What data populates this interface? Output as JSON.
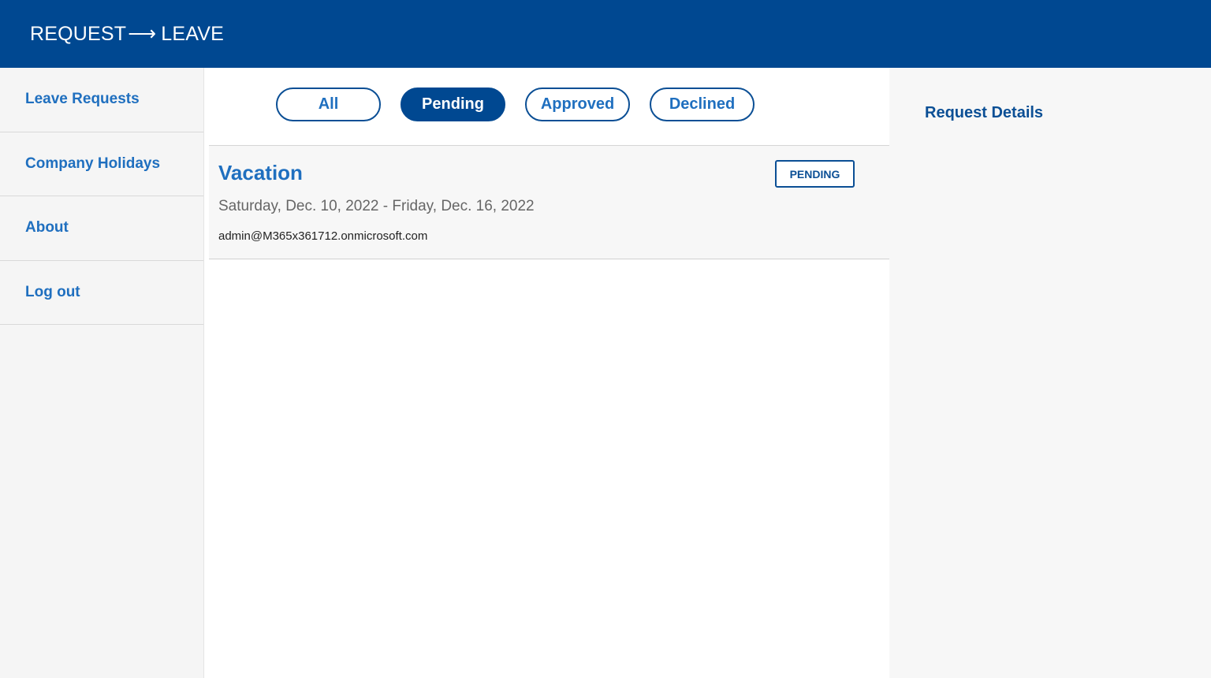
{
  "header": {
    "brand_left": "REQUEST",
    "brand_arrow": "⟶",
    "brand_right": "LEAVE",
    "color": "#004891"
  },
  "sidebar": {
    "items": [
      {
        "label": "Leave Requests"
      },
      {
        "label": "Company Holidays"
      },
      {
        "label": "About"
      },
      {
        "label": "Log out"
      }
    ]
  },
  "filters": {
    "items": [
      {
        "label": "All"
      },
      {
        "label": "Pending"
      },
      {
        "label": "Approved"
      },
      {
        "label": "Declined"
      }
    ],
    "selected": "Pending"
  },
  "requests": [
    {
      "title": "Vacation",
      "dates": "Saturday, Dec. 10, 2022 - Friday, Dec. 16, 2022",
      "email": "admin@M365x361712.onmicrosoft.com",
      "status": "PENDING"
    }
  ],
  "details": {
    "title": "Request Details"
  },
  "colors": {
    "accent": "#1f6fbf",
    "brand": "#004891",
    "panel": "#f7f7f7"
  }
}
